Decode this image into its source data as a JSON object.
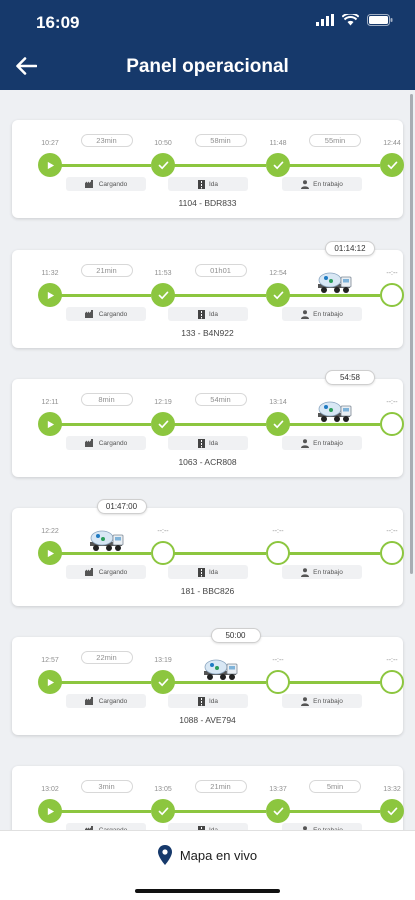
{
  "status_bar": {
    "time": "16:09"
  },
  "app_bar": {
    "title": "Panel operacional"
  },
  "stage_labels": [
    "Cargando",
    "Ida",
    "En trabajo"
  ],
  "colors": {
    "header": "#16396b",
    "accent": "#8cc63f"
  },
  "cards": [
    {
      "vehicle": "1104 - BDR833",
      "times": [
        "10:27",
        "10:50",
        "11:48",
        "12:44"
      ],
      "durations": [
        "23min",
        "58min",
        "55min"
      ],
      "completed": 4,
      "truck_segment": null,
      "elapsed": ""
    },
    {
      "vehicle": "133 - B4N922",
      "times": [
        "11:32",
        "11:53",
        "12:54",
        "--:--"
      ],
      "durations": [
        "21min",
        "01h01",
        ""
      ],
      "completed": 3,
      "truck_segment": 2,
      "elapsed": "01:14:12"
    },
    {
      "vehicle": "1063 - ACR808",
      "times": [
        "12:11",
        "12:19",
        "13:14",
        "--:--"
      ],
      "durations": [
        "8min",
        "54min",
        ""
      ],
      "completed": 3,
      "truck_segment": 2,
      "elapsed": "54:58"
    },
    {
      "vehicle": "181 - BBC826",
      "times": [
        "12:22",
        "--:--",
        "--:--",
        "--:--"
      ],
      "durations": [
        "",
        "",
        ""
      ],
      "completed": 1,
      "truck_segment": 0,
      "elapsed": "01:47:00"
    },
    {
      "vehicle": "1088 - AVE794",
      "times": [
        "12:57",
        "13:19",
        "--:--",
        "--:--"
      ],
      "durations": [
        "22min",
        "",
        ""
      ],
      "completed": 2,
      "truck_segment": 1,
      "elapsed": "50:00"
    },
    {
      "vehicle": "",
      "times": [
        "13:02",
        "13:05",
        "13:37",
        "13:32"
      ],
      "durations": [
        "3min",
        "21min",
        "5min"
      ],
      "completed": 4,
      "truck_segment": null,
      "elapsed": ""
    }
  ],
  "bottom_bar": {
    "map_label": "Mapa en vivo"
  }
}
